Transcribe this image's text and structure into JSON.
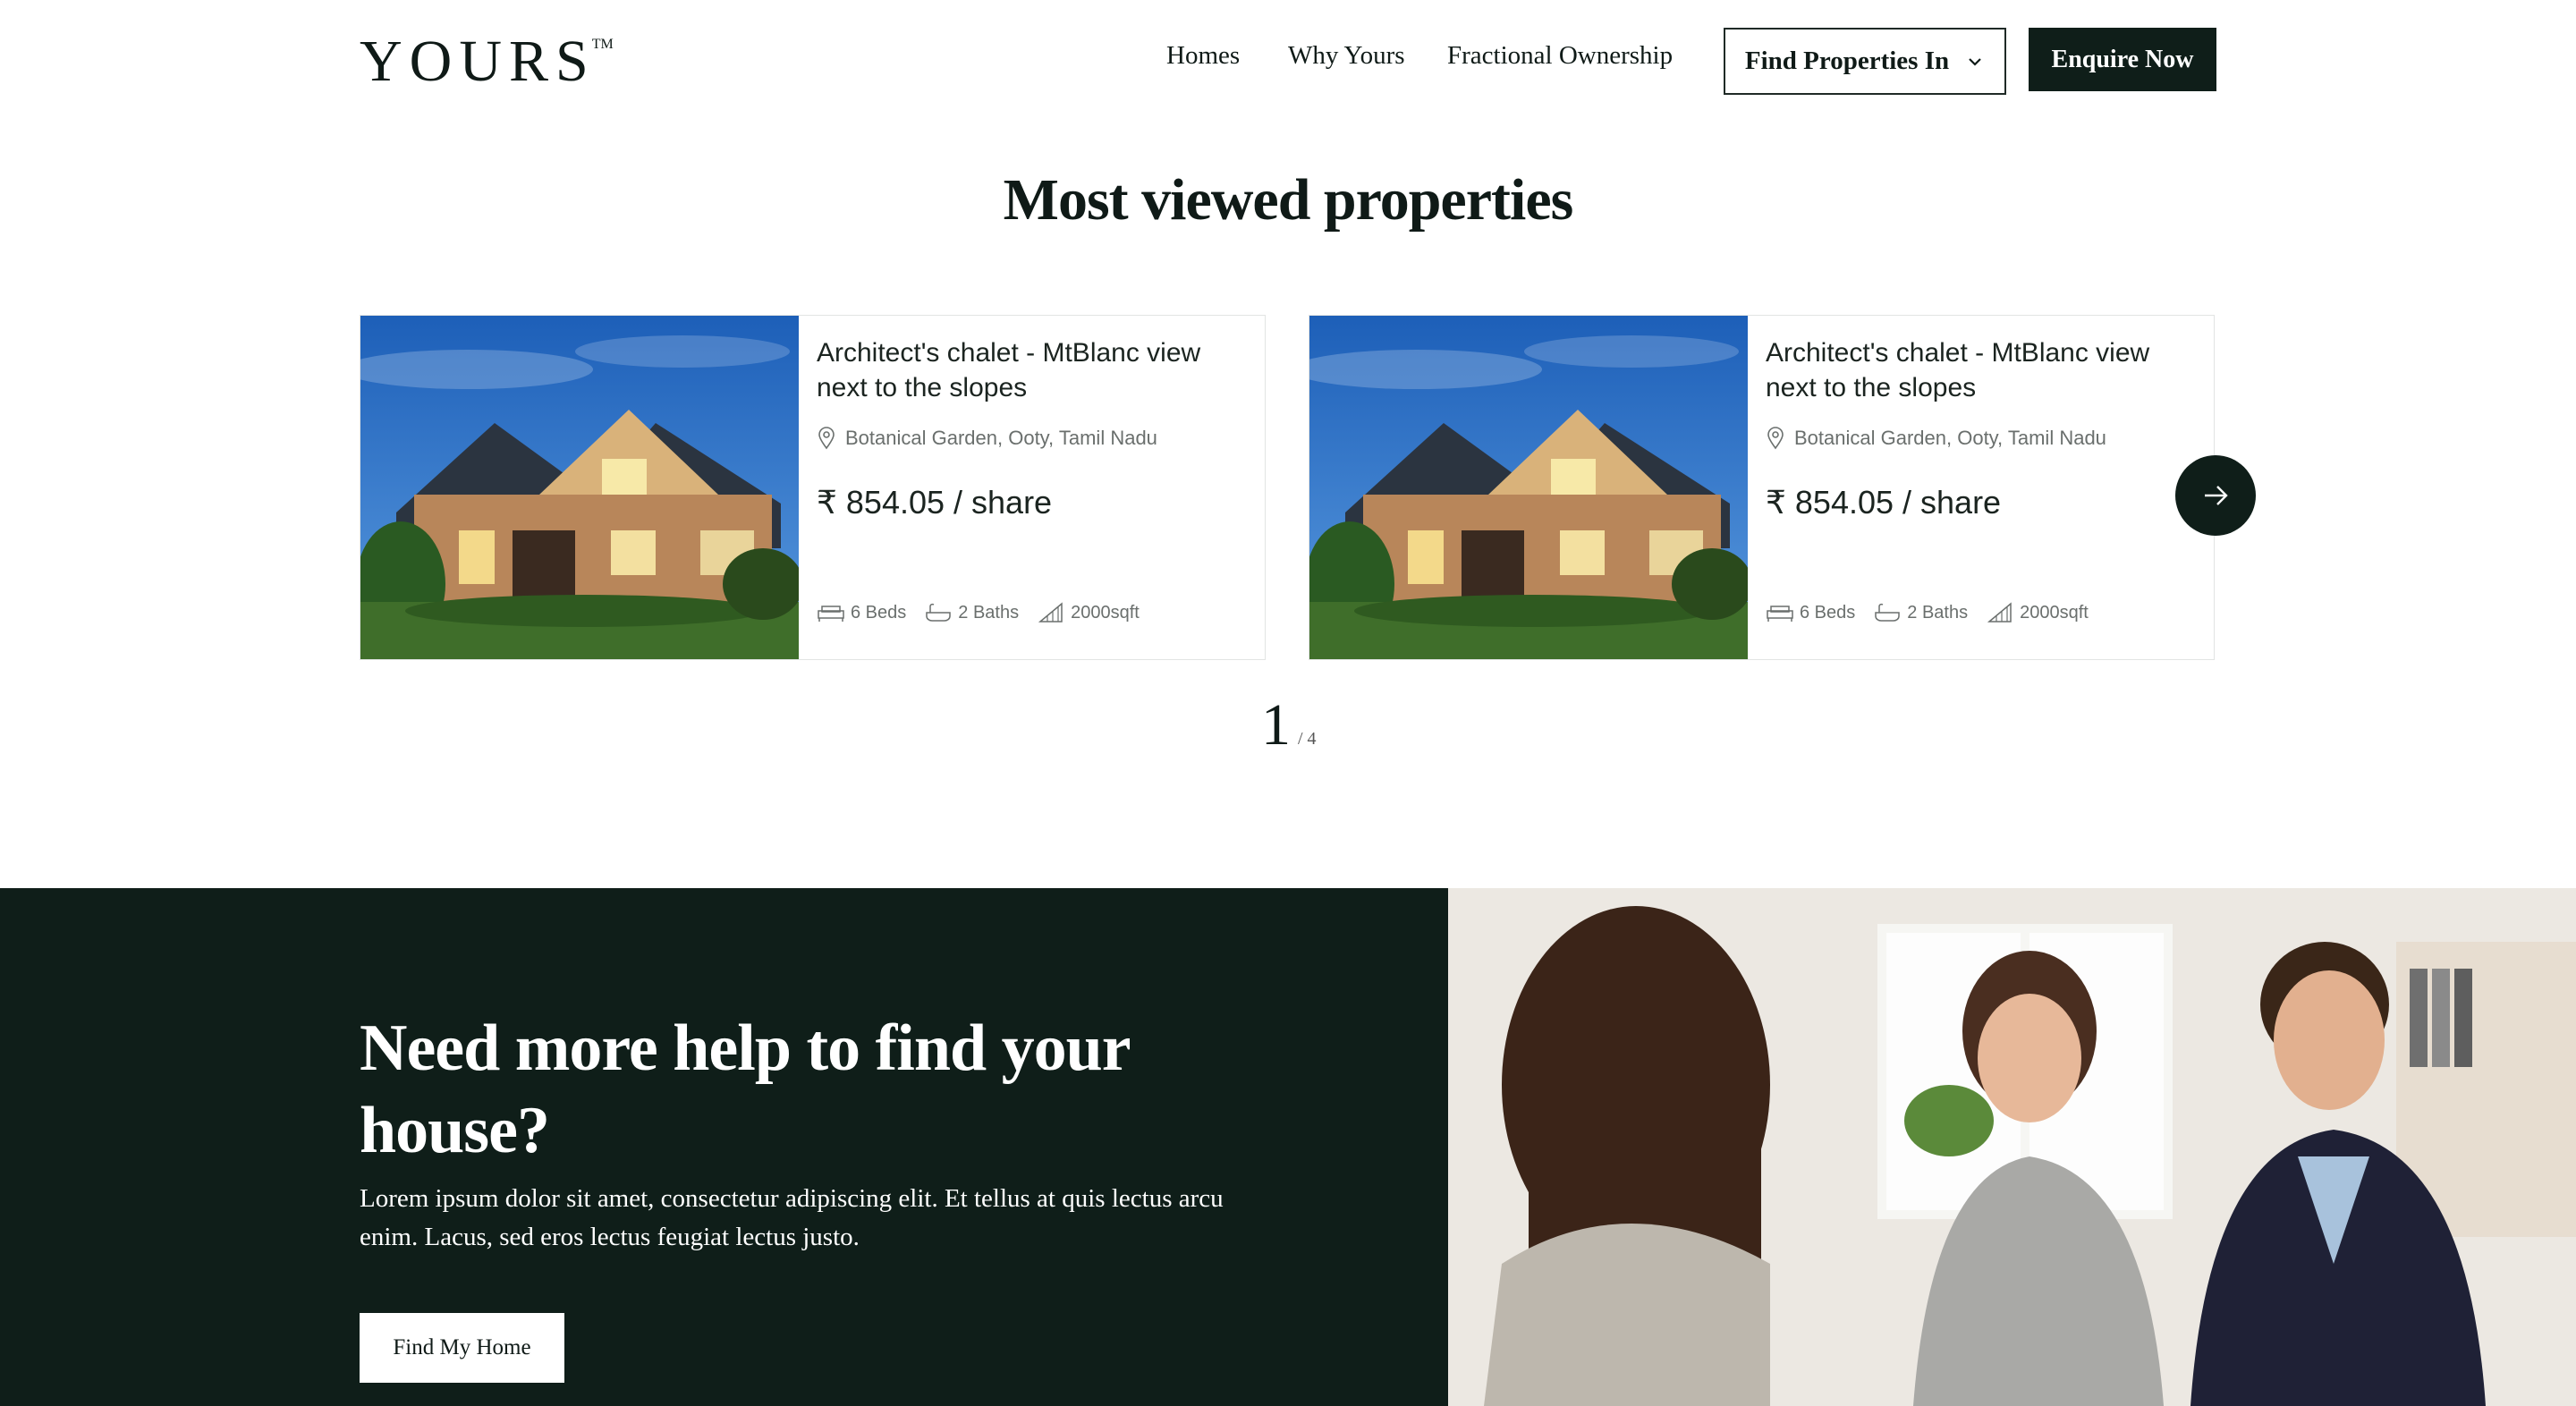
{
  "header": {
    "logo": "YOURS",
    "logo_mark": "TM",
    "nav": [
      "Homes",
      "Why Yours",
      "Fractional Ownership"
    ],
    "find_properties_label": "Find Properties In",
    "enquire_label": "Enquire Now"
  },
  "section_title": "Most viewed properties",
  "cards": [
    {
      "title": "Architect's chalet - MtBlanc view next to the slopes",
      "location": "Botanical Garden, Ooty, Tamil Nadu",
      "price": "₹ 854.05 / share",
      "beds": "6 Beds",
      "baths": "2 Baths",
      "area": "2000sqft"
    },
    {
      "title": "Architect's chalet - MtBlanc view next to the slopes",
      "location": "Botanical Garden, Ooty, Tamil Nadu",
      "price": "₹ 854.05 / share",
      "beds": "6 Beds",
      "baths": "2 Baths",
      "area": "2000sqft"
    }
  ],
  "pager": {
    "current": "1",
    "total": "/ 4"
  },
  "help": {
    "title": "Need more help to find your house?",
    "text": "Lorem ipsum dolor sit amet, consectetur adipiscing elit. Et tellus at quis lectus arcu enim. Lacus, sed eros lectus feugiat lectus justo.",
    "button_label": "Find My Home"
  },
  "colors": {
    "dark_green": "#0f1e19",
    "text": "#0f1a17",
    "muted": "#6a6f6d"
  }
}
